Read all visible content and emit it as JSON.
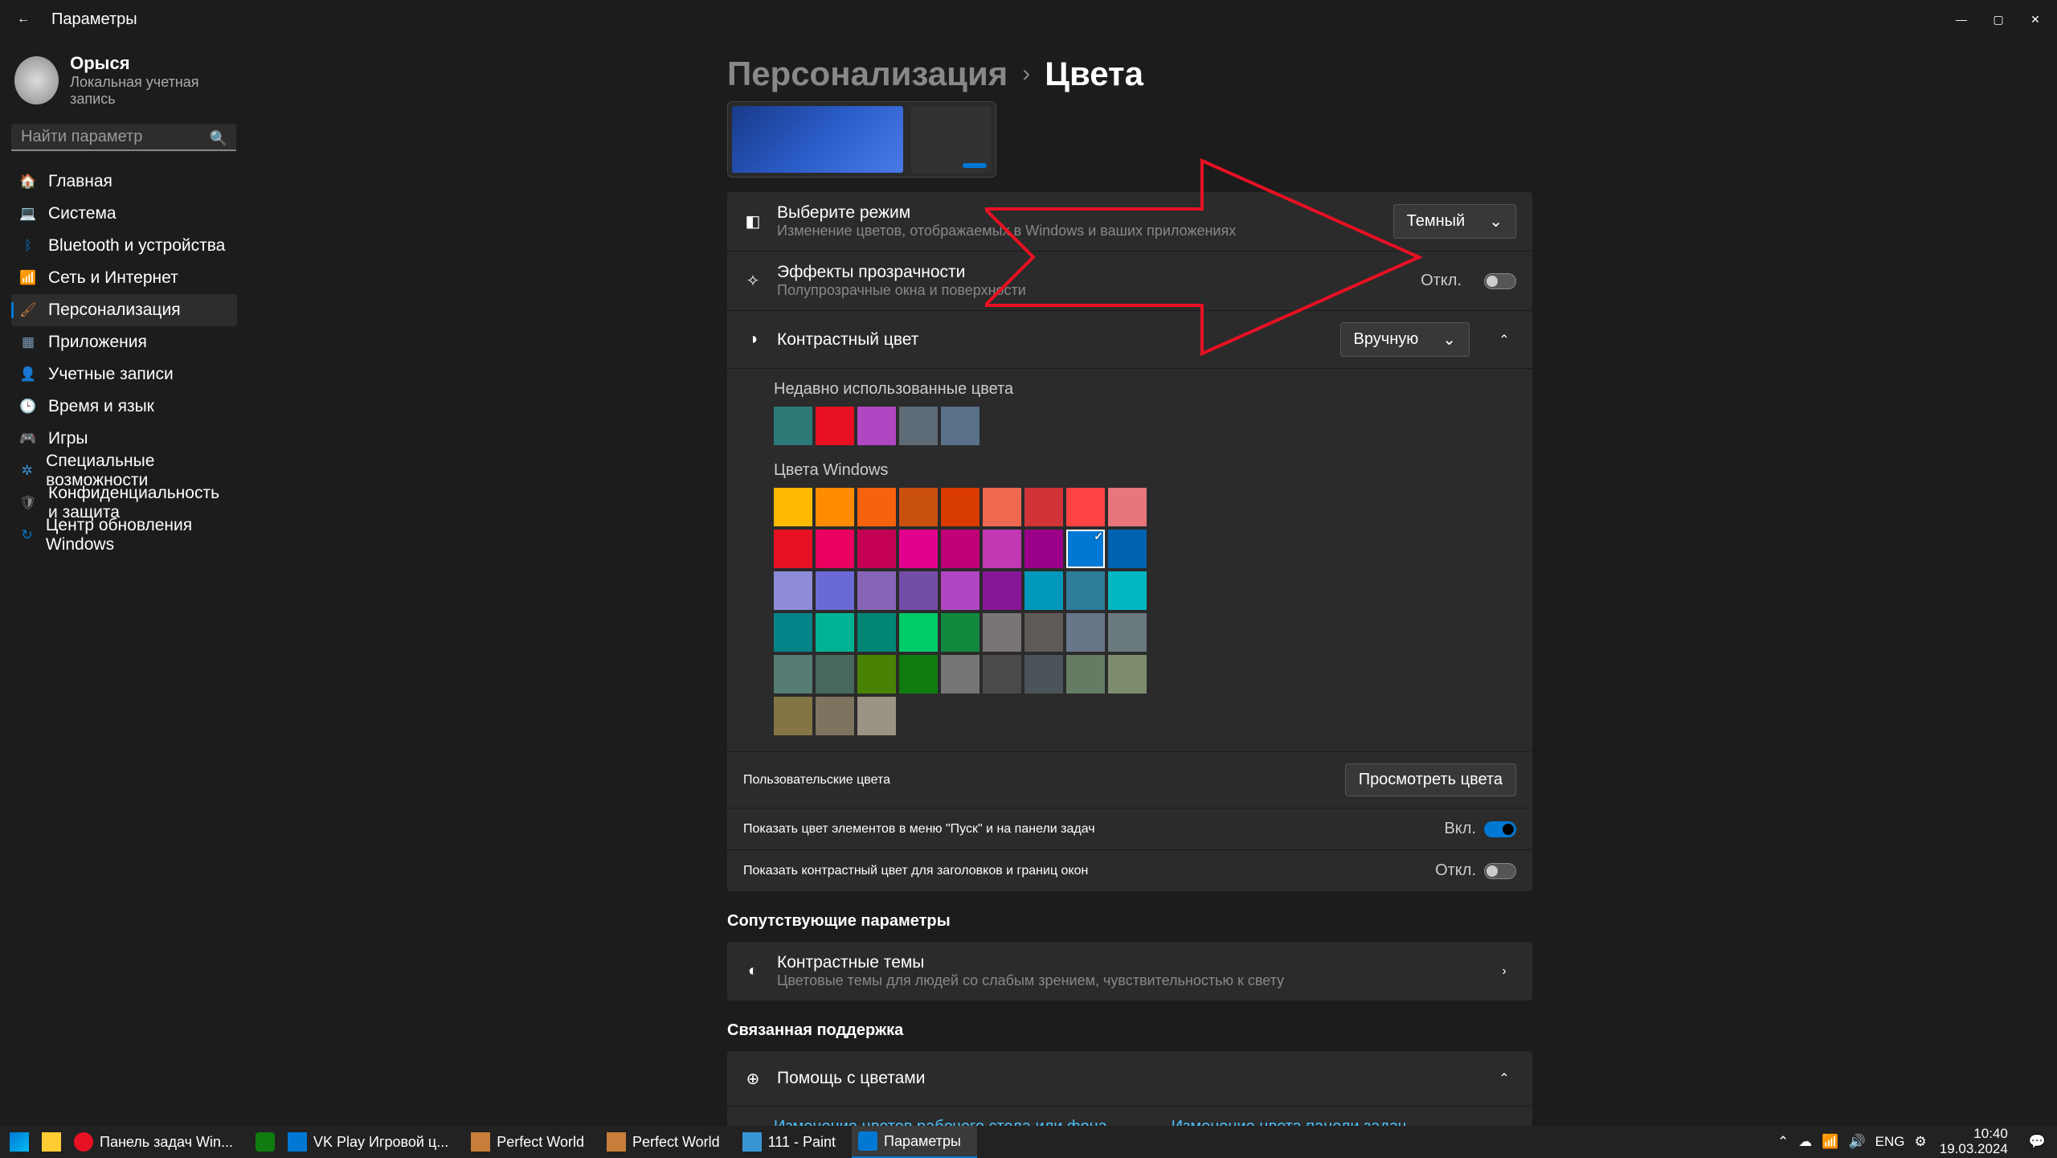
{
  "window": {
    "title": "Параметры"
  },
  "user": {
    "name": "Орыся",
    "subtitle": "Локальная учетная запись"
  },
  "search": {
    "placeholder": "Найти параметр"
  },
  "nav": {
    "items": [
      {
        "label": "Главная",
        "icon": "🏠",
        "color": "#f28c28"
      },
      {
        "label": "Система",
        "icon": "💻",
        "color": "#0078d4"
      },
      {
        "label": "Bluetooth и устройства",
        "icon": "ᛒ",
        "color": "#0078d4"
      },
      {
        "label": "Сеть и Интернет",
        "icon": "📶",
        "color": "#2aa9e0"
      },
      {
        "label": "Персонализация",
        "icon": "🖌",
        "color": "#c87d3a"
      },
      {
        "label": "Приложения",
        "icon": "▦",
        "color": "#7a9ab8"
      },
      {
        "label": "Учетные записи",
        "icon": "👤",
        "color": "#3a95d6"
      },
      {
        "label": "Время и язык",
        "icon": "🕒",
        "color": "#c15aa3"
      },
      {
        "label": "Игры",
        "icon": "🎮",
        "color": "#888"
      },
      {
        "label": "Специальные возможности",
        "icon": "✲",
        "color": "#3a95d6"
      },
      {
        "label": "Конфиденциальность и защита",
        "icon": "🛡",
        "color": "#888"
      },
      {
        "label": "Центр обновления Windows",
        "icon": "↻",
        "color": "#0078d4"
      }
    ],
    "active_index": 4
  },
  "breadcrumb": {
    "parent": "Персонализация",
    "current": "Цвета"
  },
  "settings": {
    "mode": {
      "title": "Выберите режим",
      "sub": "Изменение цветов, отображаемых в Windows и ваших приложениях",
      "value": "Темный"
    },
    "transparency": {
      "title": "Эффекты прозрачности",
      "sub": "Полупрозрачные окна и поверхности",
      "state_label": "Откл.",
      "on": false
    },
    "accent": {
      "title": "Контрастный цвет",
      "value": "Вручную"
    },
    "recent_label": "Недавно использованные цвета",
    "recent_colors": [
      "#2b7a78",
      "#e81123",
      "#b146c2",
      "#5d6b76",
      "#597089"
    ],
    "windows_label": "Цвета Windows",
    "windows_colors": [
      "#ffb900",
      "#ff8c00",
      "#f7630c",
      "#ca5010",
      "#da3b01",
      "#ef6950",
      "#d13438",
      "#ff4343",
      "#e74856",
      "#e81123",
      "#ea005e",
      "#c30052",
      "#e3008c",
      "#bf0077",
      "#c239b3",
      "#9a0089",
      "#8e8cd8",
      "#6b69d6",
      "#8764b8",
      "#744da9",
      "#b146c2",
      "#881798",
      "#0099bc",
      "#2d7d9a",
      "#038387",
      "#00b294",
      "#018574",
      "#00cc6a",
      "#10893e",
      "#7a7574",
      "#5d5a58",
      "#68768a",
      "#567c73",
      "#486860",
      "#498205",
      "#107c10",
      "#767676",
      "#4c4a48",
      "#69797e",
      "#4a5459",
      "#647c64",
      "#525e54",
      "#847545"
    ],
    "windows_selected_index": 15,
    "more_colors": [
      "#0078d4",
      "#0063b1"
    ],
    "custom_label": "Пользовательские цвета",
    "custom_button": "Просмотреть цвета",
    "start_taskbar": {
      "label": "Показать цвет элементов в меню \"Пуск\" и на панели задач",
      "state_label": "Вкл.",
      "on": true
    },
    "titlebars": {
      "label": "Показать контрастный цвет для заголовков и границ окон",
      "state_label": "Откл.",
      "on": false
    }
  },
  "related": {
    "heading": "Сопутствующие параметры",
    "contrast": {
      "title": "Контрастные темы",
      "sub": "Цветовые темы для людей со слабым зрением, чувствительностью к свету"
    }
  },
  "support": {
    "heading": "Связанная поддержка",
    "help_title": "Помощь с цветами",
    "link1": "Изменение цветов рабочего стола или фона",
    "link2": "Изменение цвета панели задач"
  },
  "taskbar": {
    "items": [
      {
        "label": ""
      },
      {
        "label": ""
      },
      {
        "label": "Панель задач Win..."
      },
      {
        "label": ""
      },
      {
        "label": "VK Play Игровой ц..."
      },
      {
        "label": "Perfect World"
      },
      {
        "label": "Perfect World"
      },
      {
        "label": "111 - Paint"
      },
      {
        "label": "Параметры"
      }
    ],
    "lang": "ENG",
    "time": "10:40",
    "date": "19.03.2024"
  }
}
